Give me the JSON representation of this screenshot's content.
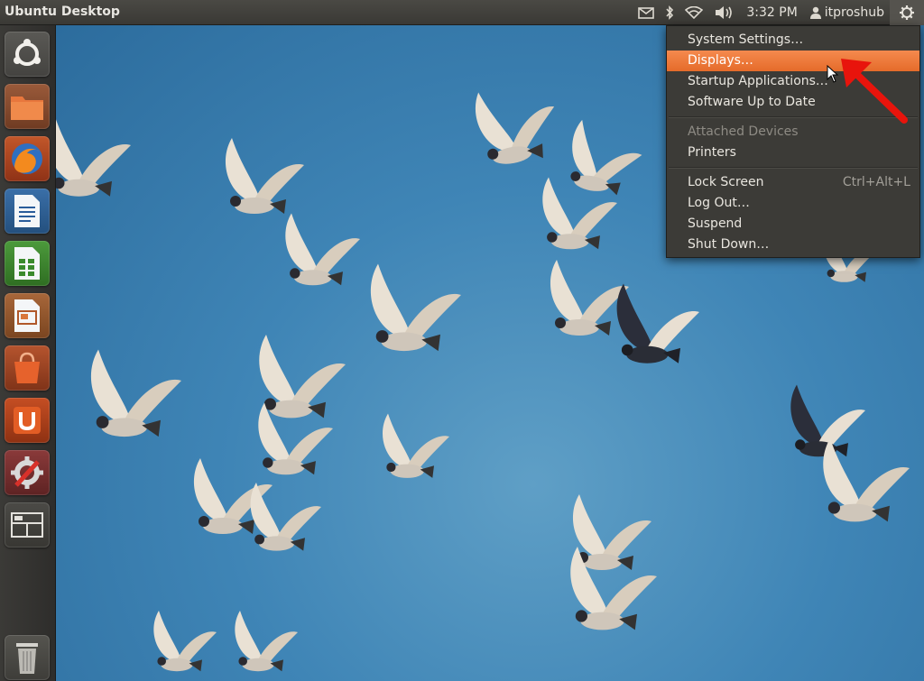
{
  "panel": {
    "title": "Ubuntu Desktop",
    "time": "3:32 PM",
    "user": "itproshub"
  },
  "menu": {
    "items": [
      {
        "label": "System Settings…"
      },
      {
        "label": "Displays…"
      },
      {
        "label": "Startup Applications…"
      },
      {
        "label": "Software Up to Date"
      },
      {
        "label": "Attached Devices"
      },
      {
        "label": "Printers"
      },
      {
        "label": "Lock Screen",
        "shortcut": "Ctrl+Alt+L"
      },
      {
        "label": "Log Out…"
      },
      {
        "label": "Suspend"
      },
      {
        "label": "Shut Down…"
      }
    ]
  },
  "launcher": {
    "items": [
      {
        "icon": "ubuntu-dash-icon"
      },
      {
        "icon": "home-folder-icon"
      },
      {
        "icon": "firefox-icon"
      },
      {
        "icon": "libreoffice-writer-icon"
      },
      {
        "icon": "libreoffice-calc-icon"
      },
      {
        "icon": "libreoffice-impress-icon"
      },
      {
        "icon": "software-center-icon"
      },
      {
        "icon": "ubuntu-one-icon"
      },
      {
        "icon": "system-settings-icon"
      },
      {
        "icon": "workspace-switcher-icon"
      },
      {
        "icon": "trash-icon"
      }
    ]
  },
  "colors": {
    "highlight": "#e56b2a",
    "panel": "#3c3b37",
    "wallpaper": "#3f85b6",
    "annotation_arrow": "#e8140c"
  }
}
